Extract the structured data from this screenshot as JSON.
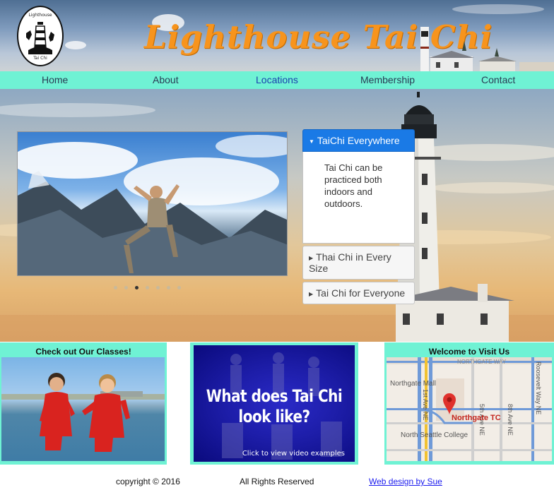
{
  "header": {
    "title": "Lighthouse Tai Chi",
    "logo_top": "Lighthouse",
    "logo_bottom": "Tai Chi"
  },
  "nav": {
    "items": [
      {
        "label": "Home"
      },
      {
        "label": "About"
      },
      {
        "label": "Locations"
      },
      {
        "label": "Membership"
      },
      {
        "label": "Contact"
      }
    ]
  },
  "carousel": {
    "slide_count": 7,
    "active_index": 2
  },
  "accordion": {
    "sections": [
      {
        "title": "TaiChi Everywhere",
        "body": "Tai Chi can be practiced both indoors and outdoors.",
        "open": true
      },
      {
        "title": "Thai Chi in Every Size",
        "open": false
      },
      {
        "title": "Tai Chi for Everyone",
        "open": false
      }
    ]
  },
  "panels": {
    "classes_title": "Check out Our Classes!",
    "video_text": "What does Tai Chi look like?",
    "video_subtext": "Click to view video examples",
    "visit_title": "Welcome to Visit Us",
    "map_labels": {
      "street1": "NORTHGATE WAY",
      "mall": "Northgate Mall",
      "avenue1": "5th Ave NE",
      "avenue2": "8th Ave NE",
      "avenue3": "Roosevelt Way NE",
      "avenue4": "1st Ave NE",
      "pin": "Northgate TC",
      "college": "North Seattle College"
    }
  },
  "footer": {
    "copyright": "copyright © 2016",
    "rights": "All Rights Reserved",
    "credit": "Web design by Sue"
  },
  "colors": {
    "nav_bg": "#6ff2d4",
    "title_orange": "#f7941d",
    "accordion_active": "#1a7ae6",
    "map_pin": "#e0312c"
  }
}
